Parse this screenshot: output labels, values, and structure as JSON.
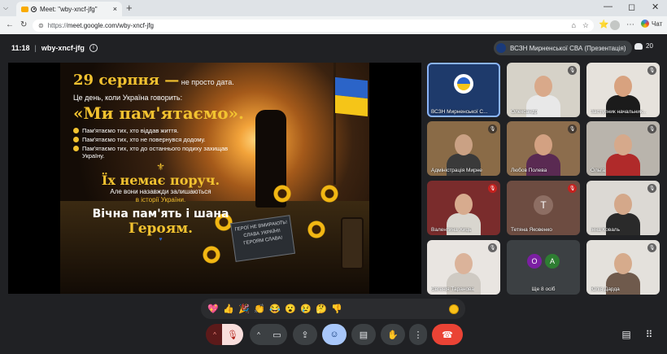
{
  "browser": {
    "tab_title": "Meet: \"wby-xncf-jfg\"",
    "tab_close": "×",
    "new_tab": "+",
    "tab_list": "⌵",
    "window_controls": [
      "—",
      "◻",
      "✕"
    ],
    "nav": [
      "←",
      "↻",
      "⊜"
    ],
    "url_scheme": "https://",
    "url_rest": "meet.google.com/wby-xncf-jfg",
    "omni_icons": [
      "⌂",
      "☆"
    ],
    "toolbar_icons": [
      "⭐",
      "⋯"
    ],
    "chat_label": "Чат"
  },
  "meeting": {
    "time": "11:18",
    "separator": "|",
    "code": "wby-xncf-jfg",
    "info": "i",
    "presenter_chip": "ВСЗН Мирненської СВА (Презентація)",
    "participant_count": "20"
  },
  "slide": {
    "date": "29 серпня —",
    "date_tail": " не просто дата.",
    "line2": "Це день, коли Україна говорить:",
    "quote": "«Ми пам'ятаємо».",
    "bullets": [
      "Пам'ятаємо тих, хто віддав життя.",
      "Пам'ятаємо тих, хто не повернувся додому.",
      "Пам'ятаємо тих, хто до останнього подиху захищав Україну."
    ],
    "trident": "⚜",
    "absent": "Їх немає поруч.",
    "forever": "Але вони назавжди залишаються",
    "forever2": "в історії України.",
    "eternal": "Вічна пам'ять і шана",
    "heroes": "Героям.",
    "heart": "♥",
    "plaque": "ГЕРОЇ НЕ ВМИРАЮТЬ! СЛАВА УКРАЇНІ! ГЕРОЯМ СЛАВА!"
  },
  "participants": [
    {
      "name": "ВСЗН Мирненської С...",
      "kind": "logo",
      "mic": "",
      "active": true
    },
    {
      "name": "Олександр",
      "kind": "cam",
      "mic": "🎙",
      "bg": "#d6d2c8",
      "skin": "#d9a98a",
      "shirt": "#e8e8e8"
    },
    {
      "name": "Заступник начальник...",
      "kind": "cam",
      "mic": "🎙",
      "bg": "#e6e2dc",
      "skin": "#d8a27f",
      "shirt": "#1b1b1b"
    },
    {
      "name": "Адміністрація Мирне",
      "kind": "cam",
      "mic": "🎙",
      "bg": "#8a6b47",
      "skin": "#caa184",
      "shirt": "#3a3a3a"
    },
    {
      "name": "Любов Полева",
      "kind": "cam",
      "mic": "🎙",
      "bg": "#8c6d4d",
      "skin": "#d3a182",
      "shirt": "#5a2a52"
    },
    {
      "name": "Ольга",
      "kind": "cam",
      "mic": "🎙",
      "bg": "#b9b4ac",
      "skin": "#d6a98b",
      "shirt": "#b02a2a"
    },
    {
      "name": "Валентина Хиць",
      "kind": "cam",
      "mic": "🎙",
      "mic_red": true,
      "bg": "#7a2c2c",
      "skin": "#d7ab8e",
      "shirt": "#d9d6cf"
    },
    {
      "name": "Тетяна Яковенко",
      "kind": "avatar",
      "letter": "T",
      "color": "#8d6e63",
      "tile_bg": "#6d4c41",
      "mic": "🎙",
      "mic_red": true
    },
    {
      "name": "Інна Коваль",
      "kind": "cam",
      "mic": "🎙",
      "bg": "#dcd9d4",
      "skin": "#d4a88a",
      "shirt": "#2a2a2a"
    },
    {
      "name": "Євгенія Таранова",
      "kind": "cam",
      "mic": "🎙",
      "bg": "#e9e5e1",
      "skin": "#dbb39a",
      "shirt": "#cfcac3"
    },
    {
      "name": "Ще 8 осіб",
      "kind": "overflow",
      "letters": [
        "O",
        "A"
      ],
      "colors": [
        "#7b1fa2",
        "#2e7d32"
      ]
    },
    {
      "name": "Юлія Дарда",
      "kind": "cam",
      "mic": "🎙",
      "bg": "#e4e1dc",
      "skin": "#d6ab8c",
      "shirt": "#6f5a4c"
    }
  ],
  "reactions": [
    "💖",
    "👍",
    "🎉",
    "👏",
    "😂",
    "😮",
    "😢",
    "🤔",
    "👎"
  ],
  "controls": {
    "mic_caret": "^",
    "mic_icon": "🎙",
    "cam_caret": "^",
    "cam_icon": "▭",
    "present_icon": "⇪",
    "emoji_icon": "☺",
    "captions_icon": "▤",
    "hand_icon": "✋",
    "more_icon": "⋮",
    "leave_icon": "☎",
    "chat_icon": "▤",
    "activities_icon": "⠿"
  }
}
